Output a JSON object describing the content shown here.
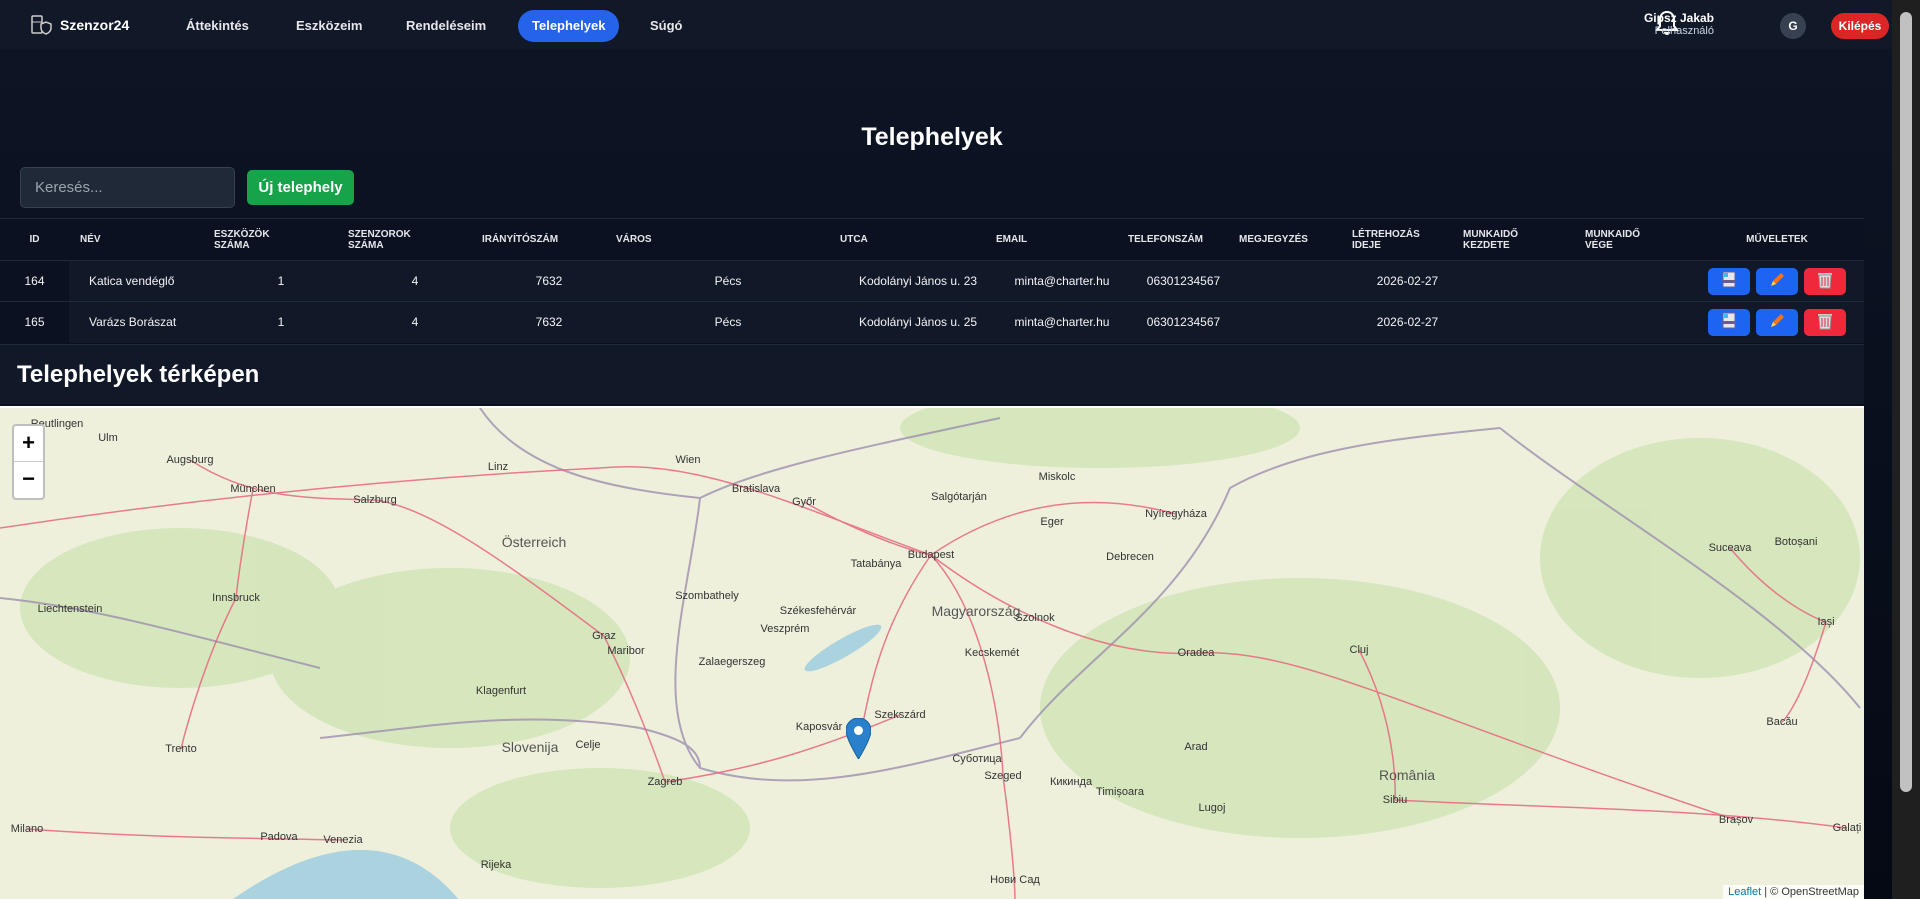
{
  "nav": {
    "brand": "Szenzor24",
    "links": [
      "Áttekintés",
      "Eszközeim",
      "Rendeléseim",
      "Telephelyek",
      "Súgó"
    ],
    "active": "Telephelyek",
    "user_name": "Gipsz Jakab",
    "user_role": "Felhasználó",
    "avatar_initial": "G",
    "logout": "Kilépés"
  },
  "page": {
    "title": "Telephelyek",
    "search_placeholder": "Keresés...",
    "new_button": "Új telephely"
  },
  "table": {
    "headers": [
      "ID",
      "NÉV",
      "ESZKÖZÖK SZÁMA",
      "SZENZOROK SZÁMA",
      "IRÁNYÍTÓSZÁM",
      "VÁROS",
      "UTCA",
      "EMAIL",
      "TELEFONSZÁM",
      "MEGJEGYZÉS",
      "LÉTREHOZÁS IDEJE",
      "MUNKAIDŐ KEZDETE",
      "MUNKAIDŐ VÉGE",
      "MŰVELETEK"
    ],
    "rows": [
      {
        "id": "164",
        "name": "Katica vendéglő",
        "devices": "1",
        "sensors": "4",
        "zip": "7632",
        "city": "Pécs",
        "street": "Kodolányi János u. 23",
        "email": "minta@charter.hu",
        "phone": "06301234567",
        "note": "",
        "created": "2026-02-27",
        "work_start": "",
        "work_end": ""
      },
      {
        "id": "165",
        "name": "Varázs Borászat",
        "devices": "1",
        "sensors": "4",
        "zip": "7632",
        "city": "Pécs",
        "street": "Kodolányi János u. 25",
        "email": "minta@charter.hu",
        "phone": "06301234567",
        "note": "",
        "created": "2026-02-27",
        "work_start": "",
        "work_end": ""
      }
    ]
  },
  "map": {
    "title": "Telephelyek térképen",
    "zoom_in": "+",
    "zoom_out": "−",
    "attribution_leaflet": "Leaflet",
    "attribution_osm": "| © OpenStreetMap",
    "labels": [
      "Reutlingen",
      "Ulm",
      "Augsburg",
      "München",
      "Linz",
      "Wien",
      "Bratislava",
      "Salzburg",
      "Österreich",
      "Innsbruck",
      "Liechtenstein",
      "Graz",
      "Maribor",
      "Klagenfurt",
      "Slovenija",
      "Celje",
      "Trento",
      "Milano",
      "Padova",
      "Venezia",
      "Rijeka",
      "Zagreb",
      "Győr",
      "Tatabánya",
      "Budapest",
      "Magyarország",
      "Székesfehérvár",
      "Veszprém",
      "Szombathely",
      "Zalaegerszeg",
      "Kaposvár",
      "Szekszárd",
      "Kecskemét",
      "Szolnok",
      "Szeged",
      "Суботица",
      "Нови Сад",
      "Salgótarján",
      "Miskolc",
      "Eger",
      "Nyíregyháza",
      "Debrecen",
      "Oradea",
      "Arad",
      "Timișoara",
      "Кикинда",
      "Lugoj",
      "Cluj",
      "Sibiu",
      "România",
      "Brașov",
      "Suceava",
      "Botoșani",
      "Iași",
      "Bacău",
      "Galați"
    ]
  },
  "colors": {
    "accent": "#2563eb",
    "success": "#16a34a",
    "danger": "#dc2626"
  }
}
